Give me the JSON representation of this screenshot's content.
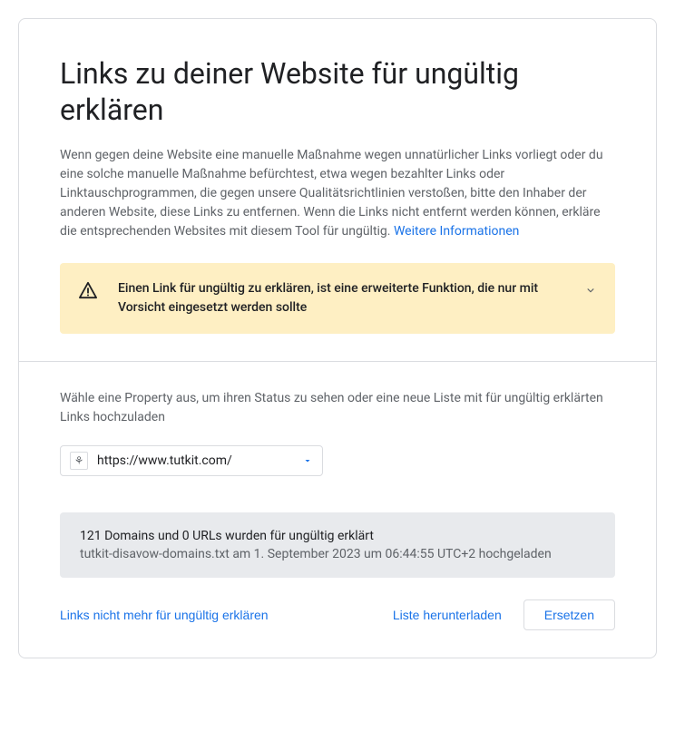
{
  "header": {
    "title": "Links zu deiner Website für ungültig erklären",
    "description": "Wenn gegen deine Website eine manuelle Maßnahme wegen unnatürlicher Links vorliegt oder du eine solche manuelle Maßnahme befürchtest, etwa wegen bezahlter Links oder Linktauschprogrammen, die gegen unsere Qualitätsrichtlinien verstoßen, bitte den Inhaber der anderen Website, diese Links zu entfernen. Wenn die Links nicht entfernt werden können, erkläre die entsprechenden Websites mit diesem Tool für ungültig. ",
    "more_info_link": "Weitere Informationen"
  },
  "warning": {
    "text": "Einen Link für ungültig zu erklären, ist eine erweiterte Funktion, die nur mit Vorsicht eingesetzt werden sollte"
  },
  "property": {
    "label": "Wähle eine Property aus, um ihren Status zu sehen oder eine neue Liste mit für ungültig erklärten Links hochzuladen",
    "selected_url": "https://www.tutkit.com/",
    "icon_glyph": "⚘"
  },
  "status": {
    "title": "121 Domains und 0 URLs wurden für ungültig erklärt",
    "detail": "tutkit-disavow-domains.txt am 1. September 2023 um 06:44:55 UTC+2 hochgeladen"
  },
  "actions": {
    "cancel_disavow": "Links nicht mehr für ungültig erklären",
    "download": "Liste herunterladen",
    "replace": "Ersetzen"
  }
}
